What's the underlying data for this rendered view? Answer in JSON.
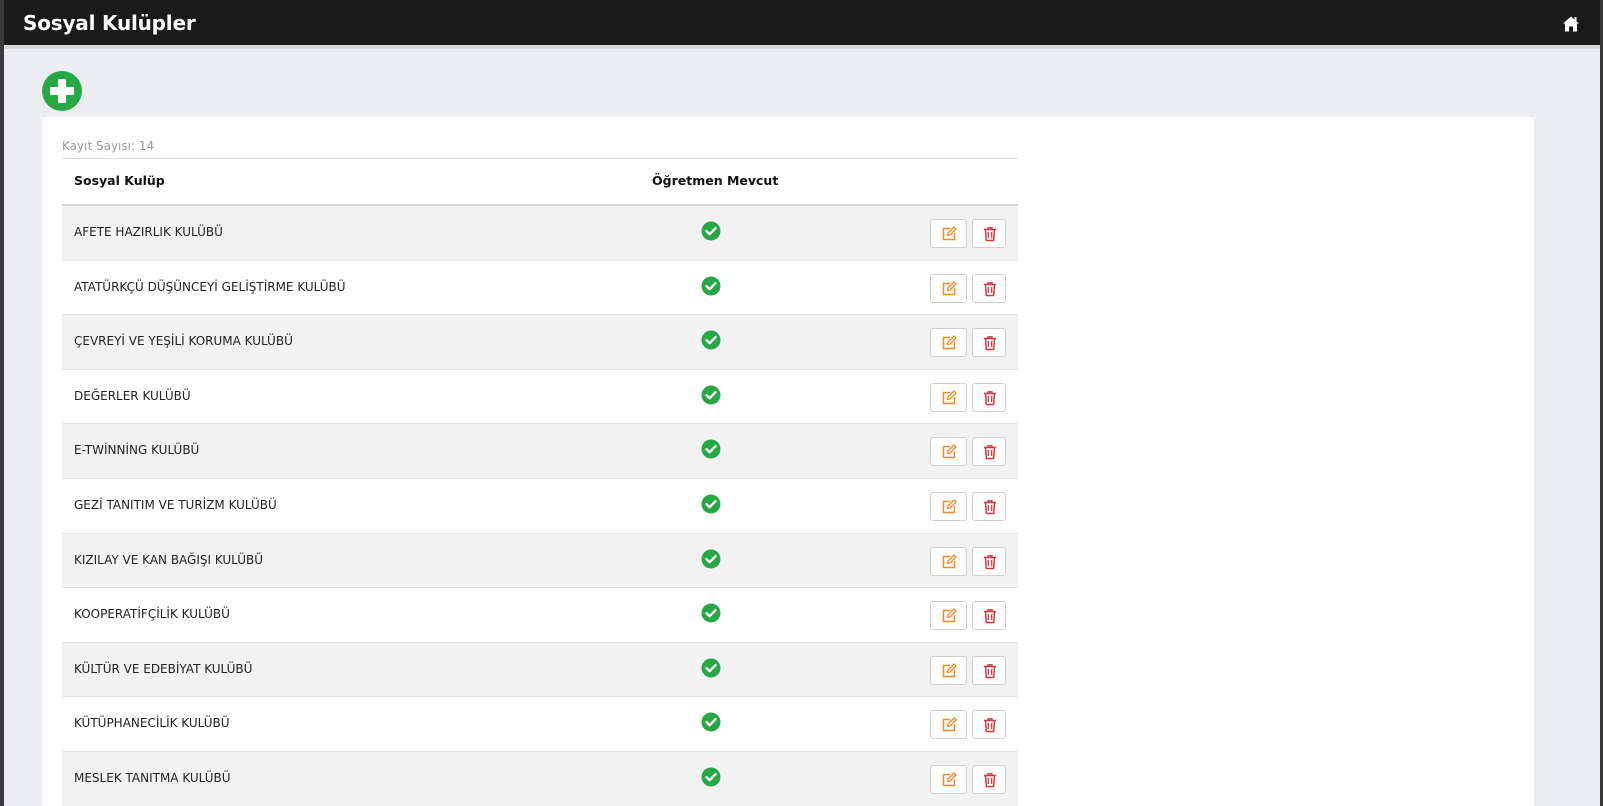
{
  "header": {
    "title": "Sosyal Kulüpler",
    "home_icon": "home-icon"
  },
  "toolbar": {
    "add_icon": "plus-circle-icon",
    "add_color": "#27a844"
  },
  "table": {
    "record_count": "Kayıt Sayısı: 14",
    "columns": [
      "Sosyal Kulüp",
      "Öğretmen Mevcut"
    ],
    "rows": [
      {
        "name": "AFETE HAZIRLIK KULÜBÜ",
        "teacher_present": true
      },
      {
        "name": "ATATÜRKÇÜ DÜŞÜNCEYİ GELİŞTİRME KULÜBÜ",
        "teacher_present": true
      },
      {
        "name": "ÇEVREYİ VE YEŞİLİ KORUMA KULÜBÜ",
        "teacher_present": true
      },
      {
        "name": "DEĞERLER KULÜBÜ",
        "teacher_present": true
      },
      {
        "name": "E-TWİNNİNG KULÜBÜ",
        "teacher_present": true
      },
      {
        "name": "GEZİ TANITIM VE TURİZM KULÜBÜ",
        "teacher_present": true
      },
      {
        "name": "KIZILAY VE KAN BAĞIŞI KULÜBÜ",
        "teacher_present": true
      },
      {
        "name": "KOOPERATİFÇİLİK KULÜBÜ",
        "teacher_present": true
      },
      {
        "name": "KÜLTÜR VE EDEBİYAT KULÜBÜ",
        "teacher_present": true
      },
      {
        "name": "KÜTÜPHANECİLİK KULÜBÜ",
        "teacher_present": true
      },
      {
        "name": "MESLEK TANITMA KULÜBÜ",
        "teacher_present": true
      }
    ],
    "icons": {
      "present": "check-circle-icon",
      "edit": "edit-icon",
      "delete": "trash-icon"
    },
    "colors": {
      "check": "#27a844",
      "edit": "#f08a24",
      "delete": "#d9343f"
    }
  }
}
